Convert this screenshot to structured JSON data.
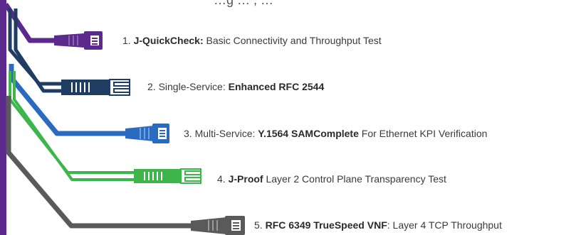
{
  "header_fragment": "…g … , …",
  "items": [
    {
      "num": "1.",
      "pre": " ",
      "bold": "J-QuickCheck:",
      "post": " Basic Connectivity and Throughput Test",
      "color": "#5b2a8c"
    },
    {
      "num": "2.",
      "pre": " Single-Service: ",
      "bold": "Enhanced RFC 2544",
      "post": "",
      "color": "#1f3c63"
    },
    {
      "num": "3.",
      "pre": " Multi-Service: ",
      "bold": "Y.1564 SAMComplete",
      "post": " For Ethernet KPI Verification",
      "color": "#2b6bbf"
    },
    {
      "num": "4.",
      "pre": " ",
      "bold": "J-Proof",
      "post": " Layer 2 Control Plane Transparency Test",
      "color": "#3db54a"
    },
    {
      "num": "5.",
      "pre": " ",
      "bold": "RFC 6349 TrueSpeed VNF",
      "post": ": Layer 4 TCP Throughput",
      "color": "#5a5a5a"
    }
  ]
}
